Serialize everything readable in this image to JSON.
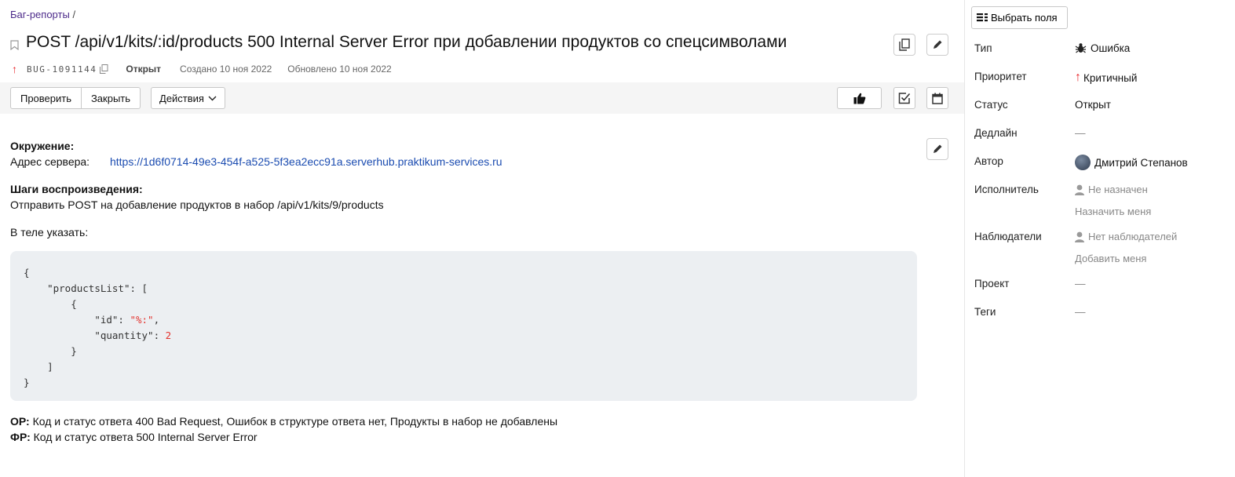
{
  "breadcrumb": {
    "parent": "Баг-репорты",
    "separator": "/"
  },
  "issue": {
    "title": "POST /api/v1/kits/:id/products 500 Internal Server Error при добавлении продуктов со спецсимволами",
    "key": "BUG-1091144",
    "status": "Открыт",
    "created": "Создано 10 ноя 2022",
    "updated": "Обновлено 10 ноя 2022",
    "priority_icon": "arrow-up-icon"
  },
  "toolbar": {
    "check": "Проверить",
    "close": "Закрыть",
    "actions": "Действия"
  },
  "description": {
    "env_heading": "Окружение:",
    "server_label": "Адрес сервера:",
    "server_url": "https://1d6f0714-49e3-454f-a525-5f3ea2ecc91a.serverhub.praktikum-services.ru",
    "steps_heading": "Шаги воспроизведения:",
    "step1": "Отправить POST на добавление продуктов в набор /api/v1/kits/9/products",
    "body_label": "В теле указать:",
    "code": {
      "l1": "{",
      "l2_key": "\"productsList\"",
      "l2_rest": ": [",
      "l3": "{",
      "l4_key": "\"id\"",
      "l4_val": "\"%:\"",
      "l5_key": "\"quantity\"",
      "l5_val": "2",
      "l6": "}",
      "l7": "]",
      "l8": "}"
    },
    "expected_label": "ОР:",
    "expected": "Код и статус ответа 400 Bad Request, Ошибок в структуре ответа нет, Продукты в набор не добавлены",
    "actual_label": "ФР:",
    "actual": "Код и статус ответа 500 Internal Server Error"
  },
  "sidebar": {
    "select_fields": "Выбрать поля",
    "type_label": "Тип",
    "type_value": "Ошибка",
    "priority_label": "Приоритет",
    "priority_value": "Критичный",
    "status_label": "Статус",
    "status_value": "Открыт",
    "deadline_label": "Дедлайн",
    "deadline_value": "—",
    "author_label": "Автор",
    "author_value": "Дмитрий Степанов",
    "assignee_label": "Исполнитель",
    "assignee_value": "Не назначен",
    "assign_me": "Назначить меня",
    "watchers_label": "Наблюдатели",
    "watchers_value": "Нет наблюдателей",
    "add_me": "Добавить меня",
    "project_label": "Проект",
    "project_value": "—",
    "tags_label": "Теги",
    "tags_value": "—"
  },
  "colors": {
    "priority": "#e8262b",
    "link": "#1a4bb0",
    "breadcrumb": "#4c2a8a"
  }
}
